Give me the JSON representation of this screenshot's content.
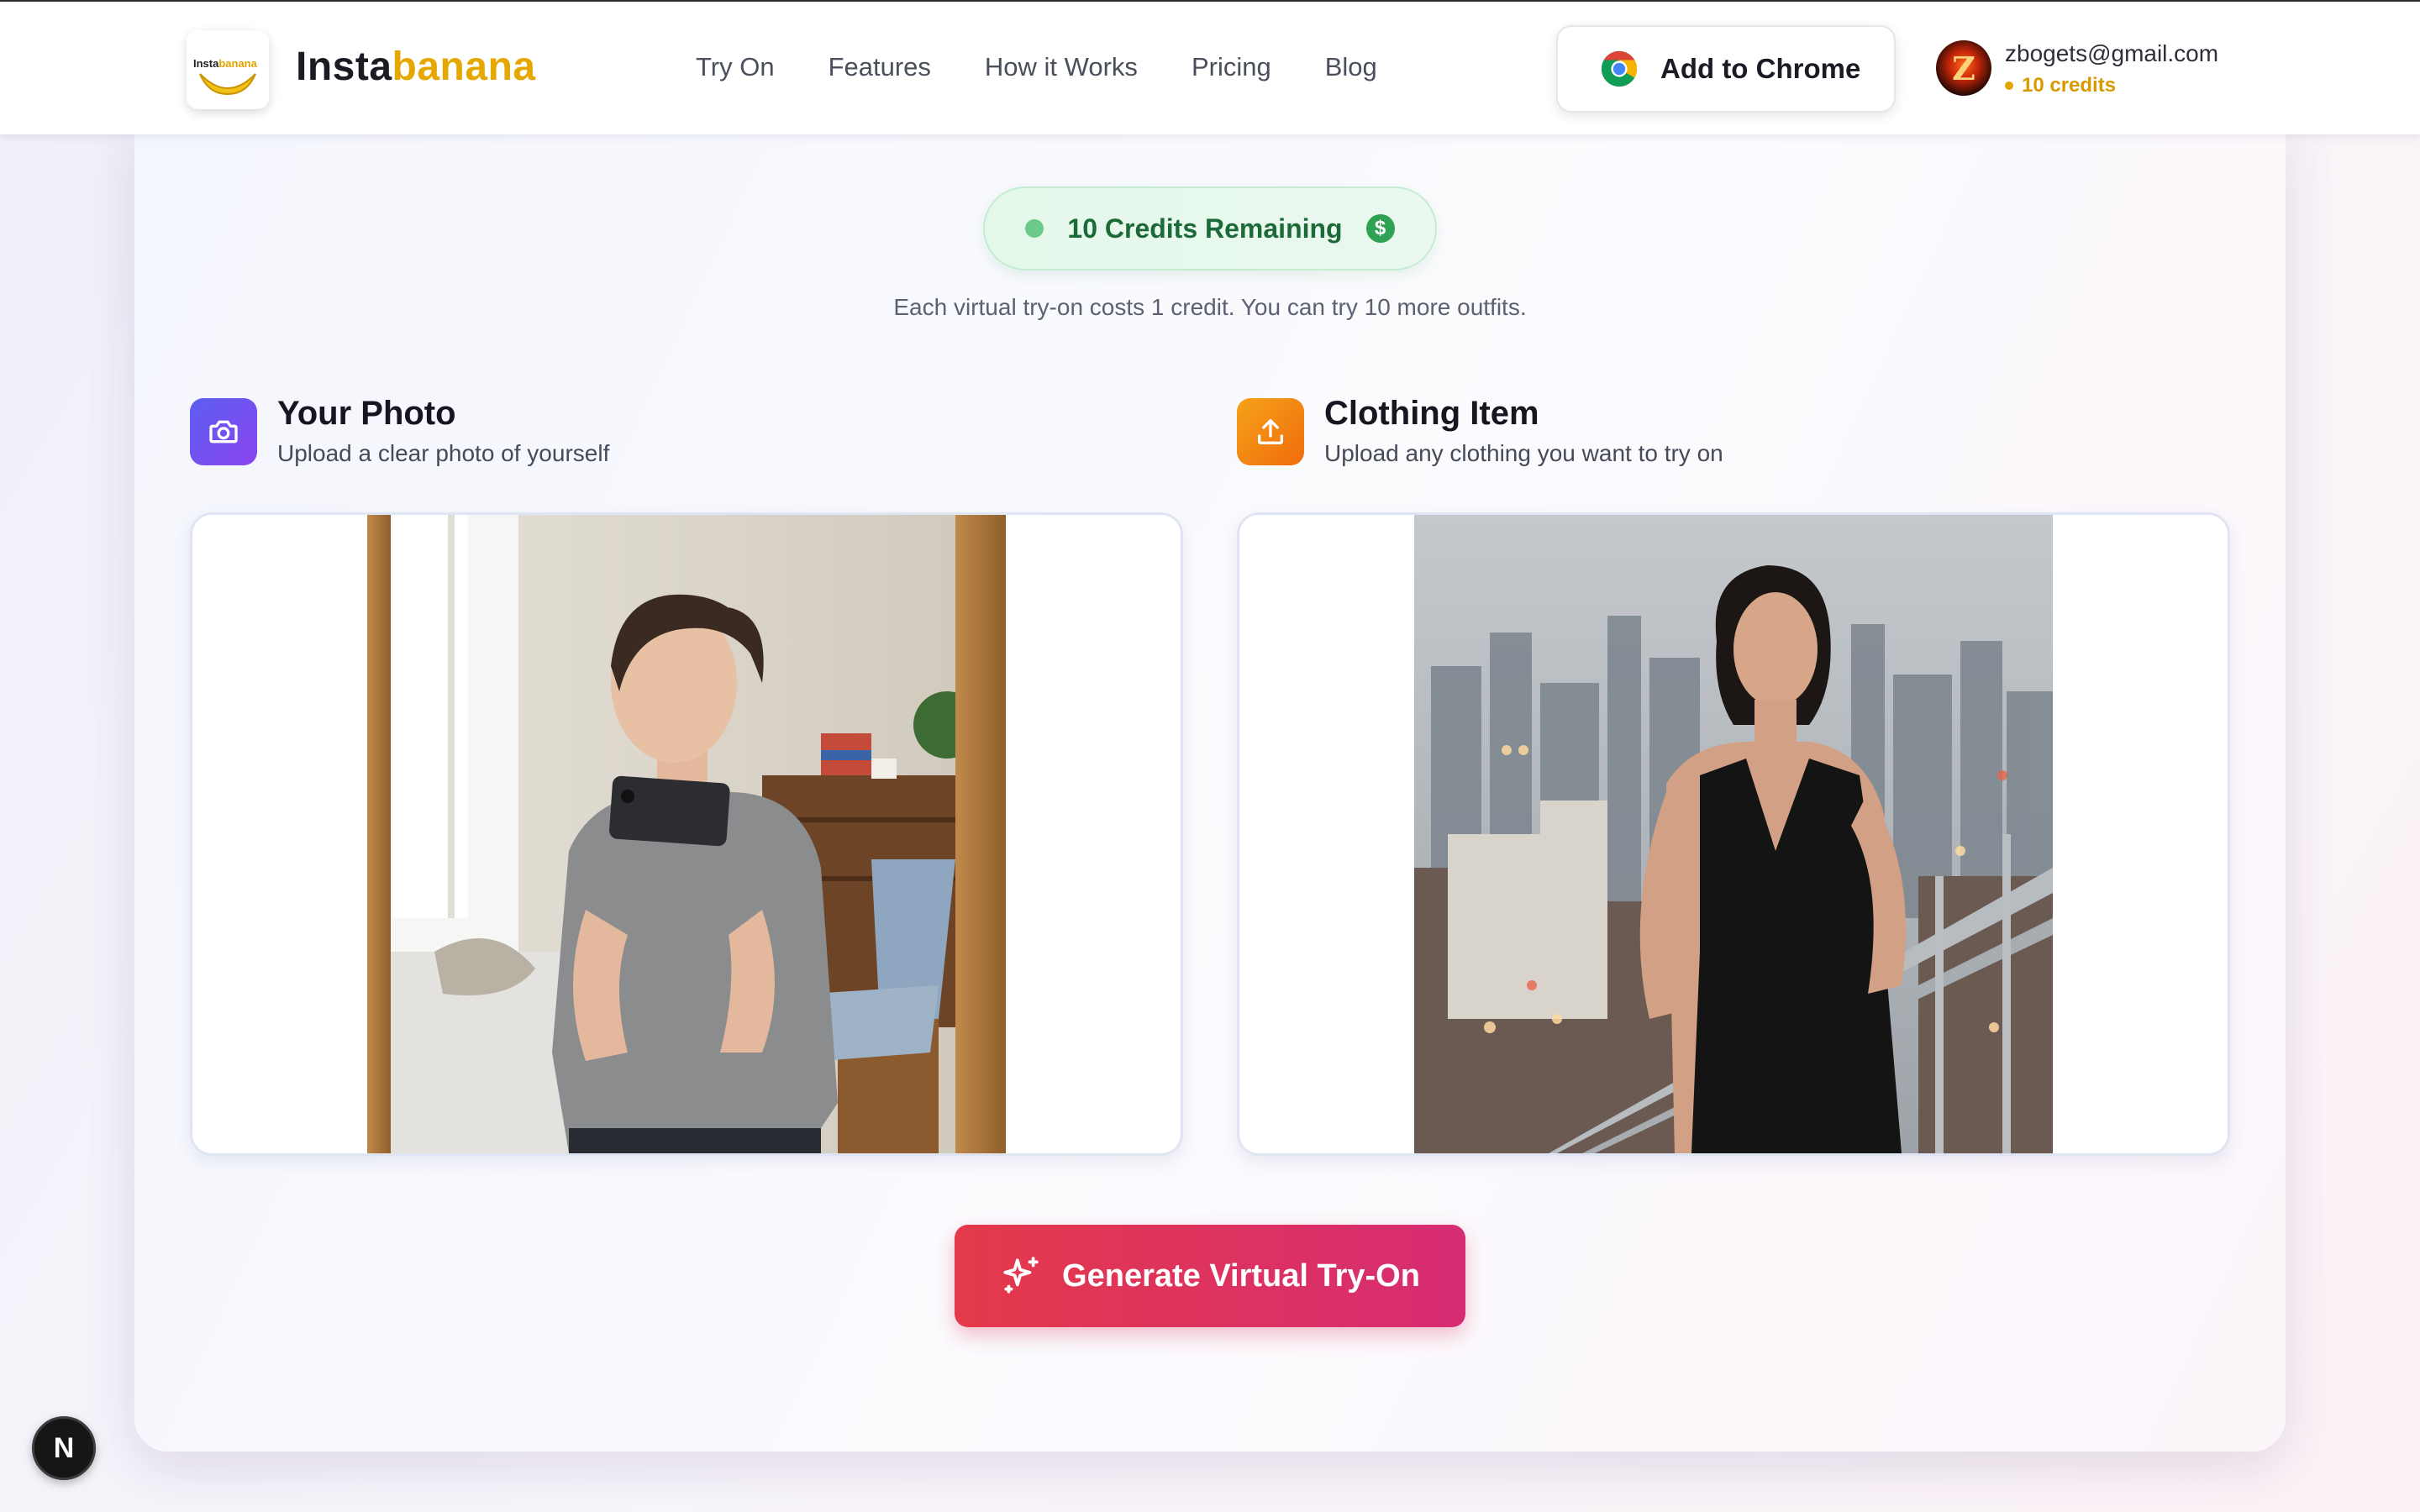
{
  "header": {
    "logo_text_a": "Insta",
    "logo_text_b": "banana",
    "brand_a": "Insta",
    "brand_b": "banana",
    "nav": [
      "Try On",
      "Features",
      "How it Works",
      "Pricing",
      "Blog"
    ],
    "chrome_button": "Add to Chrome",
    "user": {
      "avatar_letter": "Z",
      "email": "zbogets@gmail.com",
      "credits": "10 credits"
    }
  },
  "main": {
    "credits_pill": "10 Credits Remaining",
    "coin_symbol": "$",
    "subtitle": "Each virtual try-on costs 1 credit. You can try 10 more outfits.",
    "your_photo": {
      "title": "Your Photo",
      "description": "Upload a clear photo of yourself"
    },
    "clothing_item": {
      "title": "Clothing Item",
      "description": "Upload any clothing you want to try on"
    },
    "generate_button": "Generate Virtual Try-On"
  },
  "dev_badge": "N",
  "colors": {
    "brand_yellow": "#e6a800",
    "credits_green": "#1d6a39",
    "generate_gradient_start": "#e4394a",
    "generate_gradient_end": "#d62c73",
    "icon_purple": "#6b52f0",
    "icon_orange": "#f08a12"
  },
  "icons": {
    "your_photo": "camera-icon",
    "clothing_item": "upload-icon",
    "generate": "sparkle-icon",
    "chrome": "chrome-logo-icon",
    "credits": "dollar-coin-icon"
  }
}
